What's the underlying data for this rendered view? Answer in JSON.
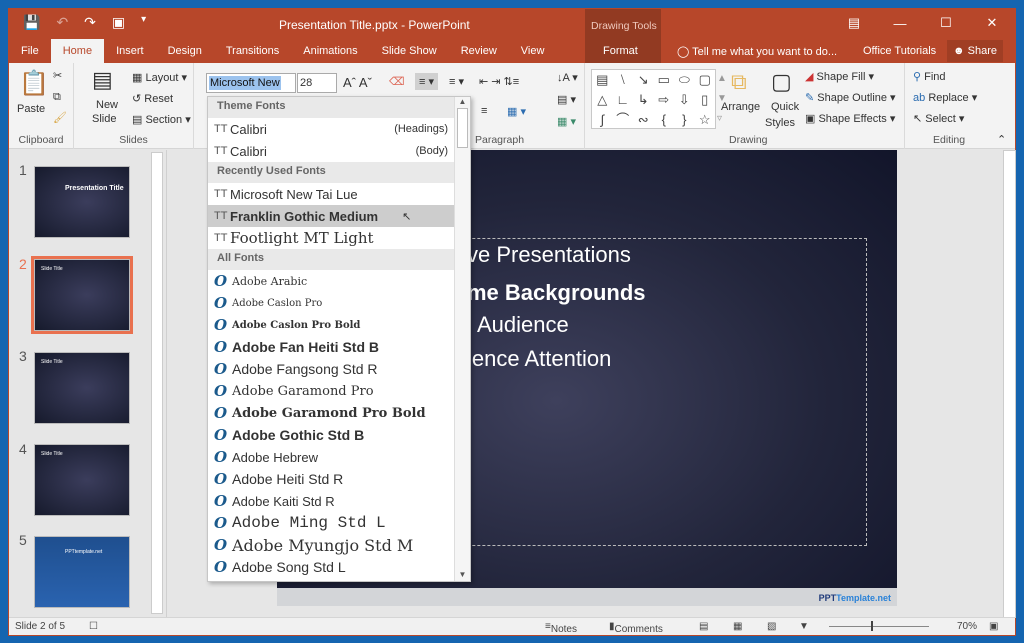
{
  "window": {
    "title": "Presentation Title.pptx - PowerPoint",
    "contextual_group": "Drawing Tools",
    "contextual_tab": "Format"
  },
  "tabs": [
    "File",
    "Home",
    "Insert",
    "Design",
    "Transitions",
    "Animations",
    "Slide Show",
    "Review",
    "View"
  ],
  "tell_me": "Tell me what you want to do...",
  "office_tutorials": "Office Tutorials",
  "share": "Share",
  "ribbon": {
    "clipboard": {
      "label": "Clipboard",
      "paste": "Paste"
    },
    "slides": {
      "label": "Slides",
      "new_slide_1": "New",
      "new_slide_2": "Slide",
      "layout": "Layout",
      "reset": "Reset",
      "section": "Section"
    },
    "font": {
      "name": "Microsoft New",
      "size": "28"
    },
    "paragraph": {
      "label": "Paragraph"
    },
    "drawing": {
      "label": "Drawing",
      "arrange": "Arrange",
      "quick_styles_1": "Quick",
      "quick_styles_2": "Styles",
      "shape_fill": "Shape Fill",
      "shape_outline": "Shape Outline",
      "shape_effects": "Shape Effects"
    },
    "editing": {
      "label": "Editing",
      "find": "Find",
      "replace": "Replace",
      "select": "Select"
    }
  },
  "font_dropdown": {
    "theme_header": "Theme Fonts",
    "theme": [
      {
        "name": "Calibri",
        "role": "(Headings)"
      },
      {
        "name": "Calibri",
        "role": "(Body)"
      }
    ],
    "recent_header": "Recently Used Fonts",
    "recent": [
      "Microsoft New Tai Lue",
      "Franklin Gothic Medium",
      "Footlight MT Light"
    ],
    "all_header": "All Fonts",
    "all": [
      "Adobe Arabic",
      "Adobe Caslon Pro",
      "Adobe Caslon Pro Bold",
      "Adobe Fan Heiti Std B",
      "Adobe Fangsong Std R",
      "Adobe Garamond Pro",
      "Adobe Garamond Pro Bold",
      "Adobe Gothic Std B",
      "Adobe Hebrew",
      "Adobe Heiti Std R",
      "Adobe Kaiti Std R",
      "Adobe Ming Std L",
      "Adobe Myungjo Std M",
      "Adobe Song Std L"
    ]
  },
  "thumbnails": [
    {
      "num": "1",
      "title": "Presentation Title"
    },
    {
      "num": "2",
      "title": "Slide Title"
    },
    {
      "num": "3",
      "title": "Slide Title"
    },
    {
      "num": "4",
      "title": "Slide Title"
    },
    {
      "num": "5",
      "title": "PPTtemplate.net"
    }
  ],
  "slide": {
    "bullets": [
      "ve Presentations",
      "me Backgrounds",
      "Audience",
      "ience Attention"
    ],
    "brand_a": "PPT",
    "brand_b": "Template.net"
  },
  "status": {
    "slide": "Slide 2 of 5",
    "notes": "Notes",
    "comments": "Comments",
    "zoom": "70%"
  },
  "colors": {
    "accent": "#b7472a"
  }
}
